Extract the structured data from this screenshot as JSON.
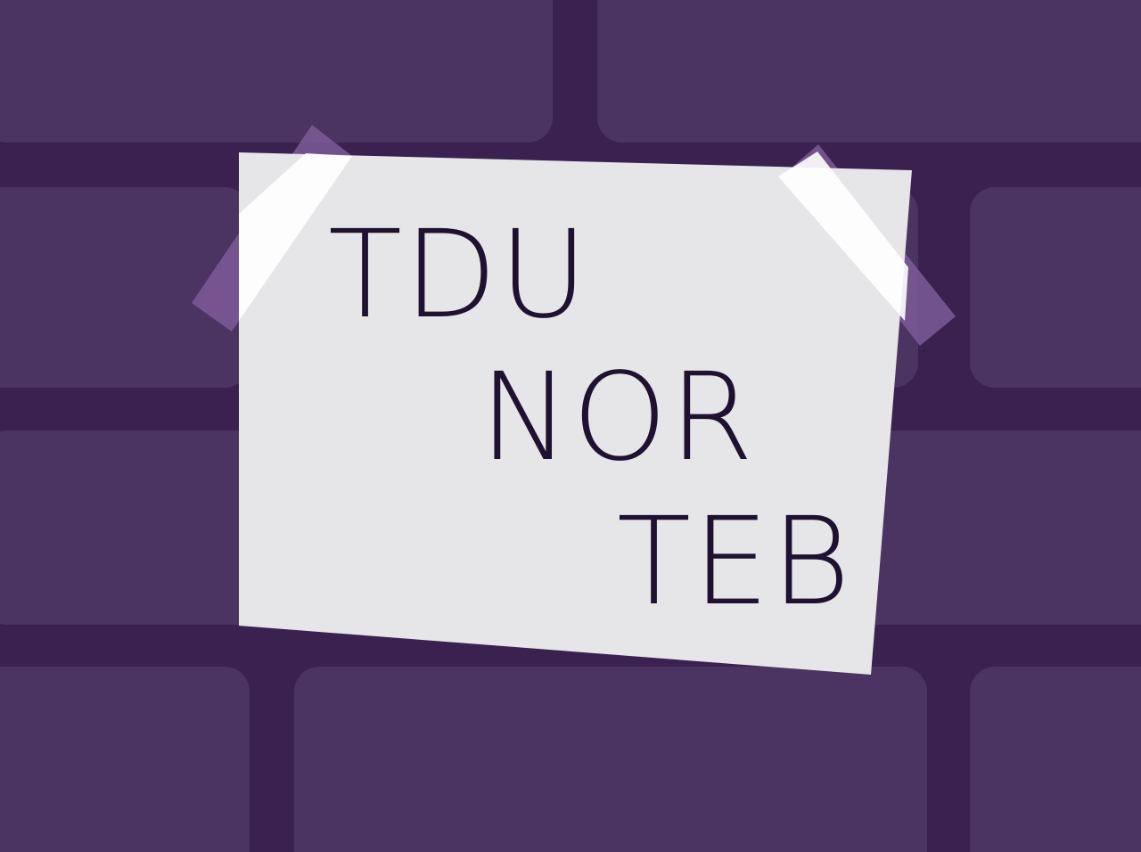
{
  "note": {
    "lines": [
      "TDU",
      "NOR",
      "TEB"
    ]
  },
  "colors": {
    "wall_mortar": "#3a2150",
    "brick": "#4b3461",
    "paper": "#e6e6e8",
    "ink": "#1f1230",
    "tape": "#f8f7f3",
    "tape_edge": "#7d5a98"
  }
}
